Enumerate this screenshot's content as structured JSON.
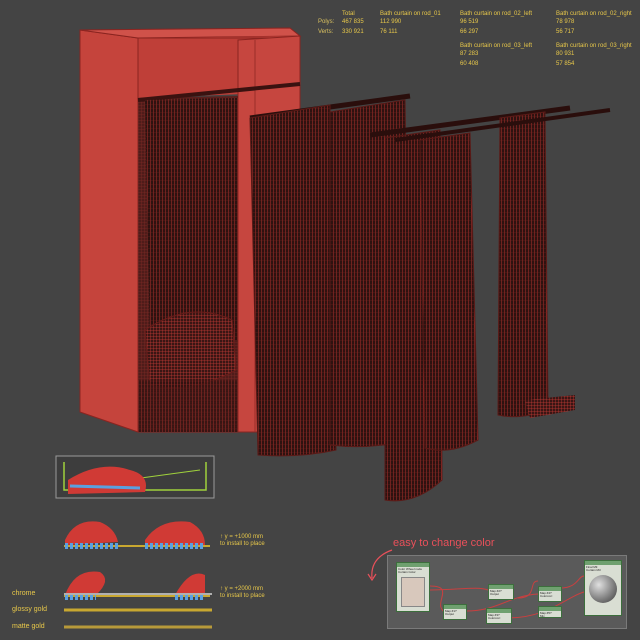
{
  "stats": {
    "row_labels": [
      "Polys:",
      "Verts:"
    ],
    "columns": [
      {
        "header": "Total",
        "polys": "467 835",
        "verts": "330 921"
      },
      {
        "header": "Bath curtain on rod_01",
        "polys": "112 990",
        "verts": "76 111"
      },
      {
        "header": "Bath curtain on rod_02_left",
        "polys": "96 519",
        "verts": "66 297"
      },
      {
        "header": "Bath curtain on rod_02_right",
        "polys": "78 978",
        "verts": "56 717"
      },
      {
        "header": "Bath curtain on rod_03_left",
        "polys": "87 283",
        "verts": "60 408"
      },
      {
        "header": "Bath curtain on rod_03_right",
        "polys": "80 931",
        "verts": "57 854"
      }
    ]
  },
  "notes": {
    "note1": "↑ y = +1000 mm\nto install to place",
    "note2": "↑ y = +2000 mm\nto install to place"
  },
  "materials": [
    "chrome",
    "glossy gold",
    "matte gold"
  ],
  "material_colors": [
    "#b0b0b0",
    "#c9a830",
    "#b89a3a"
  ],
  "callout": "easy to change color",
  "node_editor": {
    "nodes": [
      "Color Wheel node\nCurtain Color",
      "Map #1?\nOutput",
      "Map #2?\nOutput",
      "Map #3?\nColorcorr.",
      "Map #4?\nColorcorr.",
      "Map #5?\nMix",
      "Final Mtl\nCurtain Mtl"
    ]
  },
  "colors": {
    "background": "#444444",
    "wire": "#c23a35",
    "accent_text": "#e8c84a",
    "callout": "#e8505a"
  }
}
